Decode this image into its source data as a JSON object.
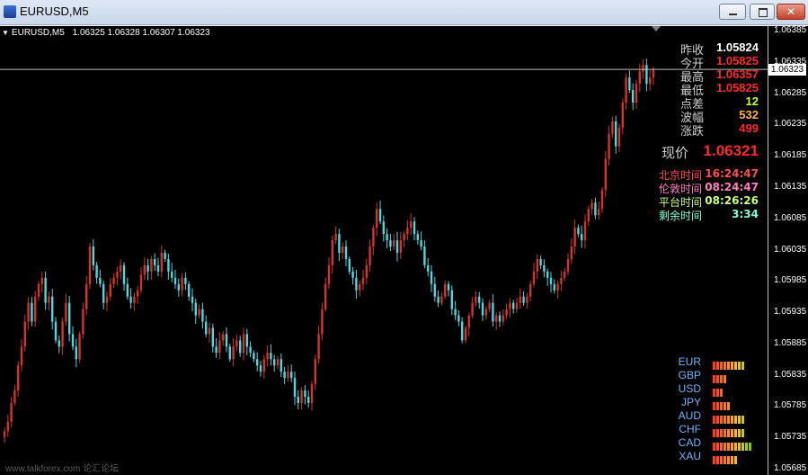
{
  "window": {
    "title": "EURUSD,M5"
  },
  "header": {
    "symbol": "EURUSD,M5",
    "open": "1.06325",
    "high": "1.06328",
    "low": "1.06307",
    "close": "1.06323"
  },
  "info": {
    "rows": [
      {
        "label": "昨收",
        "value": "1.05824",
        "color": "#ffffff"
      },
      {
        "label": "今开",
        "value": "1.05825",
        "color": "#ff2a2a"
      },
      {
        "label": "最高",
        "value": "1.06357",
        "color": "#ff2a2a"
      },
      {
        "label": "最低",
        "value": "1.05825",
        "color": "#ff2a2a"
      },
      {
        "label": "点差",
        "value": "12",
        "color": "#c8ff3c"
      },
      {
        "label": "波幅",
        "value": "532",
        "color": "#ffb040"
      },
      {
        "label": "涨跌",
        "value": "499",
        "color": "#ff2a2a"
      }
    ],
    "current": {
      "label": "现价",
      "value": "1.06321"
    },
    "times": [
      {
        "label": "北京时间",
        "value": "16:24:47",
        "color": "#ff5050"
      },
      {
        "label": "伦敦时间",
        "value": "08:24:47",
        "color": "#ff7fc0"
      },
      {
        "label": "平台时间",
        "value": "08:26:26",
        "color": "#c8ff80"
      },
      {
        "label": "剩余时间",
        "value": "3:34",
        "color": "#80ffd8"
      }
    ]
  },
  "strength": [
    {
      "code": "EUR",
      "bars": 9
    },
    {
      "code": "GBP",
      "bars": 4
    },
    {
      "code": "USD",
      "bars": 3
    },
    {
      "code": "JPY",
      "bars": 5
    },
    {
      "code": "AUD",
      "bars": 9
    },
    {
      "code": "CHF",
      "bars": 9
    },
    {
      "code": "CAD",
      "bars": 11
    },
    {
      "code": "XAU",
      "bars": 7
    }
  ],
  "watermark": "www.talkforex.com 论汇论坛",
  "colors": {
    "up": "#d4342a",
    "down": "#4fd6e0",
    "bg": "#000000",
    "grid": "#c0c0c0"
  },
  "chart_data": {
    "type": "candlestick",
    "y_ticks": [
      "1.06385",
      "1.06335",
      "1.06285",
      "1.06235",
      "1.06185",
      "1.06135",
      "1.06085",
      "1.06035",
      "1.05985",
      "1.05935",
      "1.05885",
      "1.05835",
      "1.05785",
      "1.05735",
      "1.05685"
    ],
    "ylim": [
      1.05685,
      1.06385
    ],
    "current_price": "1.06323",
    "closes": [
      1.05745,
      1.0576,
      1.0579,
      1.0581,
      1.0585,
      1.0588,
      1.0592,
      1.0595,
      1.0592,
      1.0596,
      1.0598,
      1.0599,
      1.0595,
      1.0596,
      1.0592,
      1.0589,
      1.0588,
      1.0592,
      1.0595,
      1.059,
      1.0588,
      1.0586,
      1.059,
      1.0594,
      1.0598,
      1.0604,
      1.0601,
      1.0599,
      1.0598,
      1.0595,
      1.0596,
      1.0598,
      1.0599,
      1.06,
      1.0601,
      1.0598,
      1.0596,
      1.0595,
      1.0596,
      1.0597,
      1.05995,
      1.0601,
      1.06,
      1.0602,
      1.0601,
      1.06,
      1.0603,
      1.0602,
      1.06,
      1.0599,
      1.0598,
      1.0597,
      1.0599,
      1.0598,
      1.0596,
      1.0595,
      1.0593,
      1.0594,
      1.0592,
      1.059,
      1.0591,
      1.0588,
      1.0587,
      1.0589,
      1.059,
      1.0588,
      1.0586,
      1.0588,
      1.0589,
      1.0587,
      1.059,
      1.0588,
      1.0587,
      1.0586,
      1.0585,
      1.0584,
      1.0586,
      1.0587,
      1.0586,
      1.0585,
      1.0586,
      1.0584,
      1.0583,
      1.0584,
      1.0583,
      1.058,
      1.0579,
      1.0581,
      1.058,
      1.0579,
      1.0582,
      1.0586,
      1.059,
      1.0594,
      1.0598,
      1.0601,
      1.0605,
      1.0606,
      1.0603,
      1.0604,
      1.0602,
      1.06,
      1.0599,
      1.0597,
      1.0598,
      1.0599,
      1.0601,
      1.0604,
      1.0607,
      1.061,
      1.0608,
      1.0606,
      1.0605,
      1.0604,
      1.0605,
      1.0603,
      1.0605,
      1.0606,
      1.0607,
      1.0608,
      1.0606,
      1.0605,
      1.0604,
      1.0601,
      1.06,
      1.0598,
      1.0596,
      1.0595,
      1.0596,
      1.0598,
      1.0597,
      1.0594,
      1.0593,
      1.0592,
      1.0589,
      1.0591,
      1.0593,
      1.0595,
      1.0596,
      1.0595,
      1.0593,
      1.0594,
      1.0595,
      1.0592,
      1.0593,
      1.0592,
      1.0593,
      1.0594,
      1.0595,
      1.0594,
      1.0595,
      1.0596,
      1.0595,
      1.0596,
      1.0598,
      1.06,
      1.0602,
      1.0601,
      1.06,
      1.0599,
      1.0598,
      1.0597,
      1.0598,
      1.0599,
      1.06,
      1.0602,
      1.0604,
      1.0607,
      1.0606,
      1.0605,
      1.0608,
      1.061,
      1.0611,
      1.0609,
      1.061,
      1.0613,
      1.0618,
      1.0622,
      1.0624,
      1.062,
      1.0623,
      1.0627,
      1.0631,
      1.0629,
      1.0627,
      1.063,
      1.0632,
      1.0633,
      1.063,
      1.0631,
      1.06323
    ]
  }
}
